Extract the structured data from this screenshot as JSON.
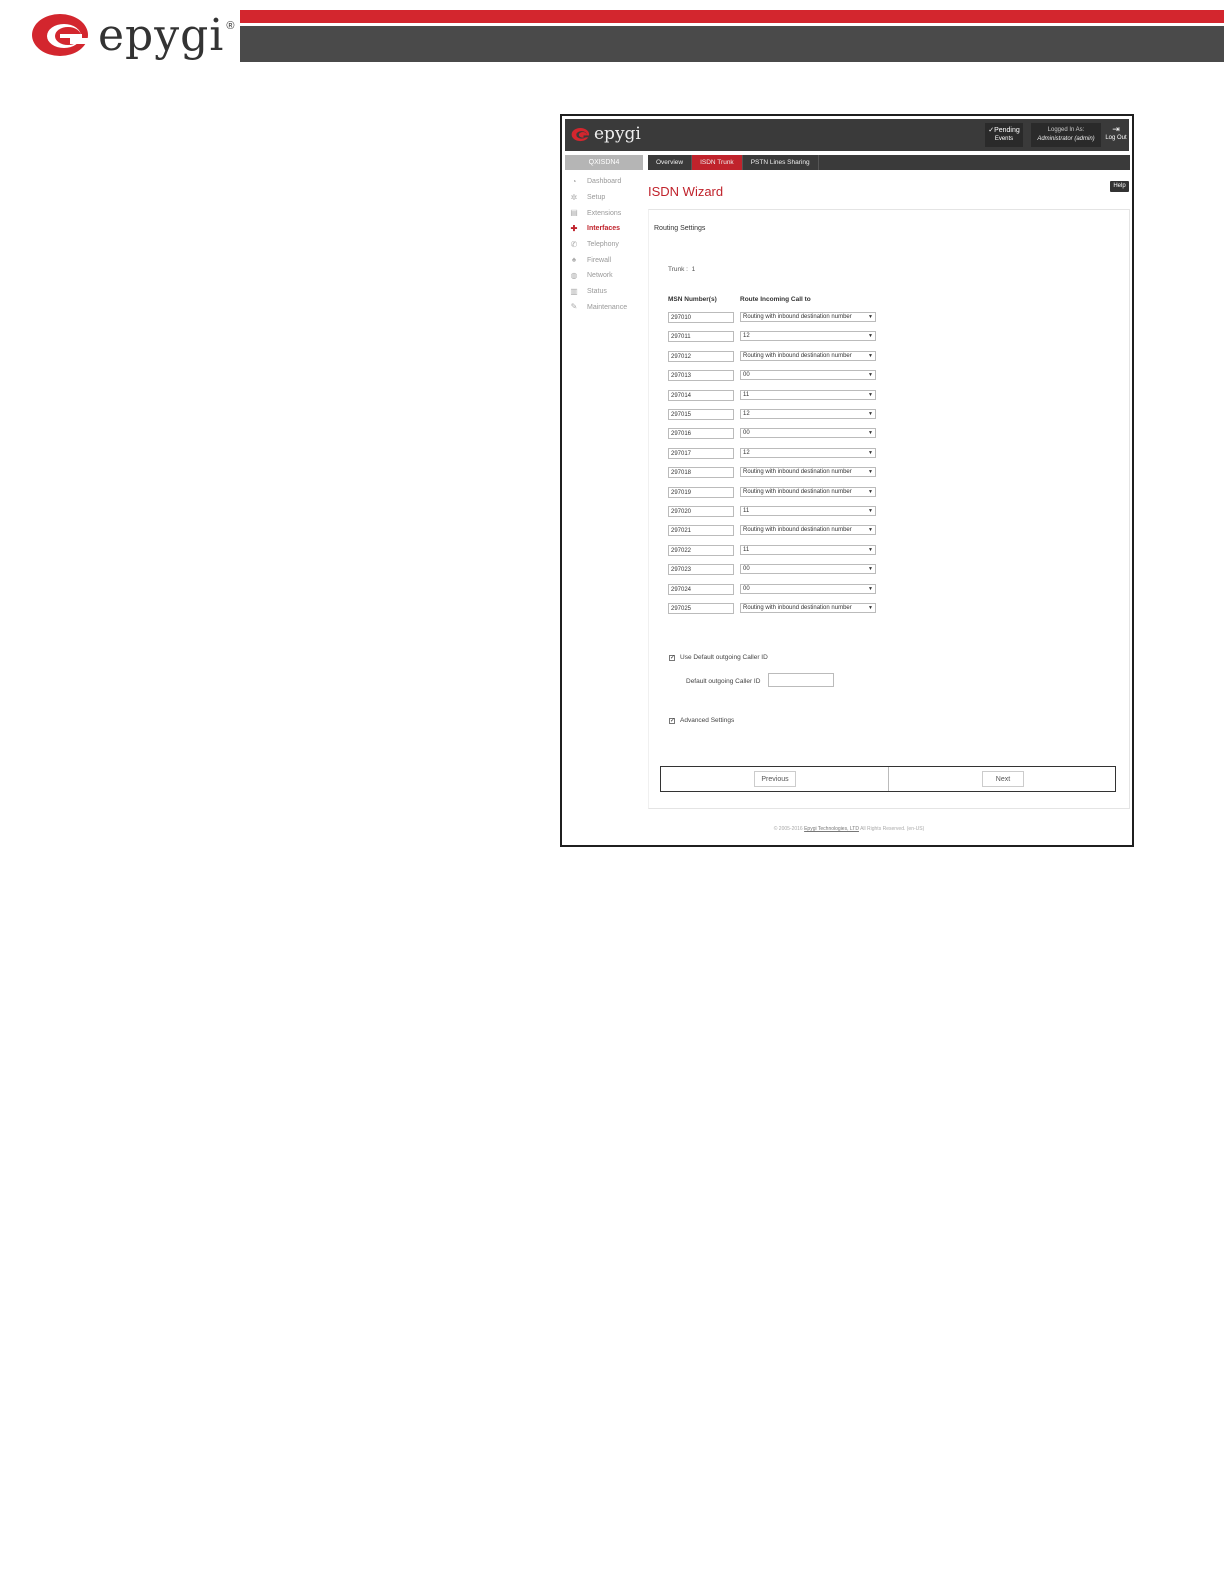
{
  "doc_header": {
    "brand": "epygi",
    "reg_mark": "®",
    "colors": {
      "red": "#d3262e",
      "dark": "#4a4a4a"
    }
  },
  "app": {
    "brand": "epygi",
    "pending": {
      "line1": "✓Pending",
      "line2": "Events"
    },
    "logged_in": {
      "label": "Logged In As:",
      "user": "Administrator (admin)"
    },
    "logout_label": "Log Out",
    "device_name": "QXISDN4",
    "nav": [
      {
        "label": "Dashboard",
        "icon": "dashboard-icon",
        "active": false
      },
      {
        "label": "Setup",
        "icon": "gear-icon",
        "active": false
      },
      {
        "label": "Extensions",
        "icon": "extensions-icon",
        "active": false
      },
      {
        "label": "Interfaces",
        "icon": "interfaces-icon",
        "active": true
      },
      {
        "label": "Telephony",
        "icon": "phone-icon",
        "active": false
      },
      {
        "label": "Firewall",
        "icon": "flame-icon",
        "active": false
      },
      {
        "label": "Network",
        "icon": "globe-icon",
        "active": false
      },
      {
        "label": "Status",
        "icon": "chart-icon",
        "active": false
      },
      {
        "label": "Maintenance",
        "icon": "wrench-icon",
        "active": false
      }
    ],
    "tabs": [
      {
        "label": "Overview",
        "active": false
      },
      {
        "label": "ISDN Trunk",
        "active": true
      },
      {
        "label": "PSTN Lines Sharing",
        "active": false
      }
    ],
    "page_title": "ISDN Wizard",
    "help_label": "Help",
    "section_title": "Routing Settings",
    "trunk_label": "Trunk :",
    "trunk_value": "1",
    "col_msn": "MSN Number(s)",
    "col_route": "Route Incoming Call to",
    "rows": [
      {
        "msn": "297010",
        "route": "Routing with inbound destination number"
      },
      {
        "msn": "297011",
        "route": "12"
      },
      {
        "msn": "297012",
        "route": "Routing with inbound destination number"
      },
      {
        "msn": "297013",
        "route": "00"
      },
      {
        "msn": "297014",
        "route": "11"
      },
      {
        "msn": "297015",
        "route": "12"
      },
      {
        "msn": "297016",
        "route": "00"
      },
      {
        "msn": "297017",
        "route": "12"
      },
      {
        "msn": "297018",
        "route": "Routing with inbound destination number"
      },
      {
        "msn": "297019",
        "route": "Routing with inbound destination number"
      },
      {
        "msn": "297020",
        "route": "11"
      },
      {
        "msn": "297021",
        "route": "Routing with inbound destination number"
      },
      {
        "msn": "297022",
        "route": "11"
      },
      {
        "msn": "297023",
        "route": "00"
      },
      {
        "msn": "297024",
        "route": "00"
      },
      {
        "msn": "297025",
        "route": "Routing with inbound destination number"
      }
    ],
    "use_default_caller_id": {
      "label": "Use Default outgoing Caller ID",
      "checked": true
    },
    "default_caller_id": {
      "label": "Default outgoing Caller ID",
      "value": ""
    },
    "advanced_settings": {
      "label": "Advanced Settings",
      "checked": true
    },
    "previous_label": "Previous",
    "next_label": "Next",
    "footer": {
      "prefix": "© 2005-2016",
      "link": "Epygi Technologies, LTD",
      "suffix": "All Rights Reserved. (en-US)"
    },
    "colors": {
      "accent": "#c0232c",
      "header": "#3a3a3a"
    }
  }
}
